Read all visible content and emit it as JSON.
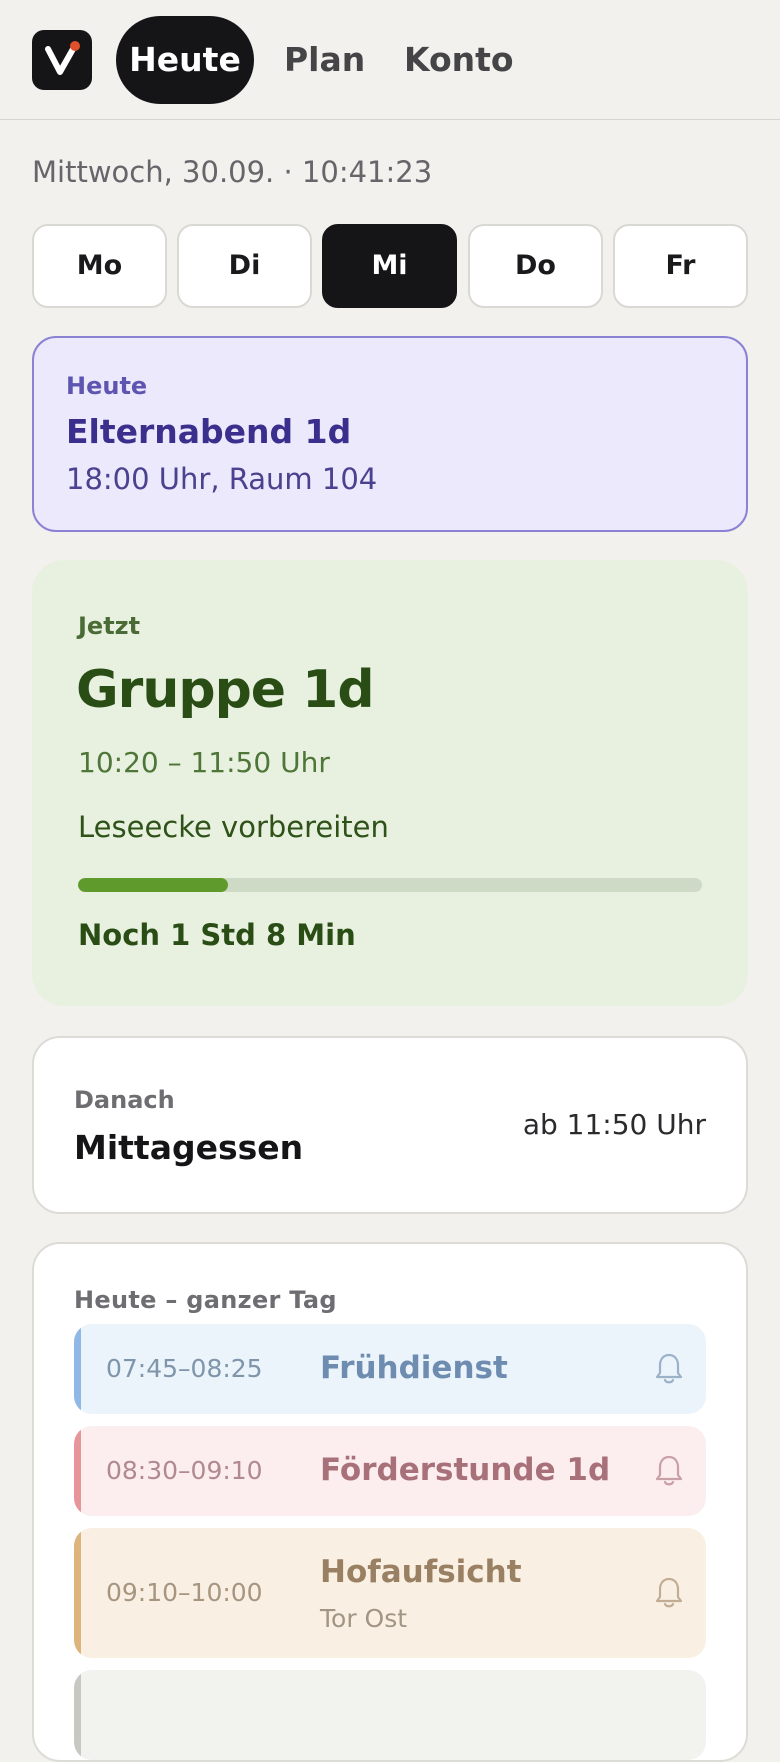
{
  "nav": {
    "tabs": [
      {
        "label": "Heute",
        "active": true
      },
      {
        "label": "Plan",
        "active": false
      },
      {
        "label": "Konto",
        "active": false
      }
    ]
  },
  "header": {
    "date_time": "Mittwoch, 30.09. · 10:41:23"
  },
  "days": [
    {
      "label": "Mo",
      "active": false
    },
    {
      "label": "Di",
      "active": false
    },
    {
      "label": "Mi",
      "active": true
    },
    {
      "label": "Do",
      "active": false
    },
    {
      "label": "Fr",
      "active": false
    }
  ],
  "event": {
    "kicker": "Heute",
    "title": "Elternabend 1d",
    "detail": "18:00 Uhr, Raum 104"
  },
  "current": {
    "kicker": "Jetzt",
    "title": "Gruppe 1d",
    "time": "10:20 – 11:50 Uhr",
    "task": "Leseecke vorbereiten",
    "progress": 0.24,
    "remaining": "Noch 1 Std 8 Min"
  },
  "next": {
    "kicker": "Danach",
    "title": "Mittagessen",
    "time": "ab 11:50 Uhr"
  },
  "schedule": {
    "title": "Heute – ganzer Tag",
    "items": [
      {
        "time": "07:45–08:25",
        "title": "Frühdienst",
        "subtitle": "",
        "icon": "bell-icon",
        "color": "#8fb8e6"
      },
      {
        "time": "08:30–09:10",
        "title": "Förderstunde 1d",
        "subtitle": "",
        "icon": "bell-icon",
        "color": "#e8949b"
      },
      {
        "time": "09:10–10:00",
        "title": "Hofaufsicht",
        "subtitle": "Tor Ost",
        "icon": "bell-icon",
        "color": "#ddb47b"
      }
    ]
  },
  "colors": {
    "background": "#f2f1ed",
    "ink": "#151518",
    "event_accent": "#8b82d6",
    "current_bg": "#e8f1df",
    "progress": "#5f9b2c",
    "logo_dot": "#e0502a"
  }
}
